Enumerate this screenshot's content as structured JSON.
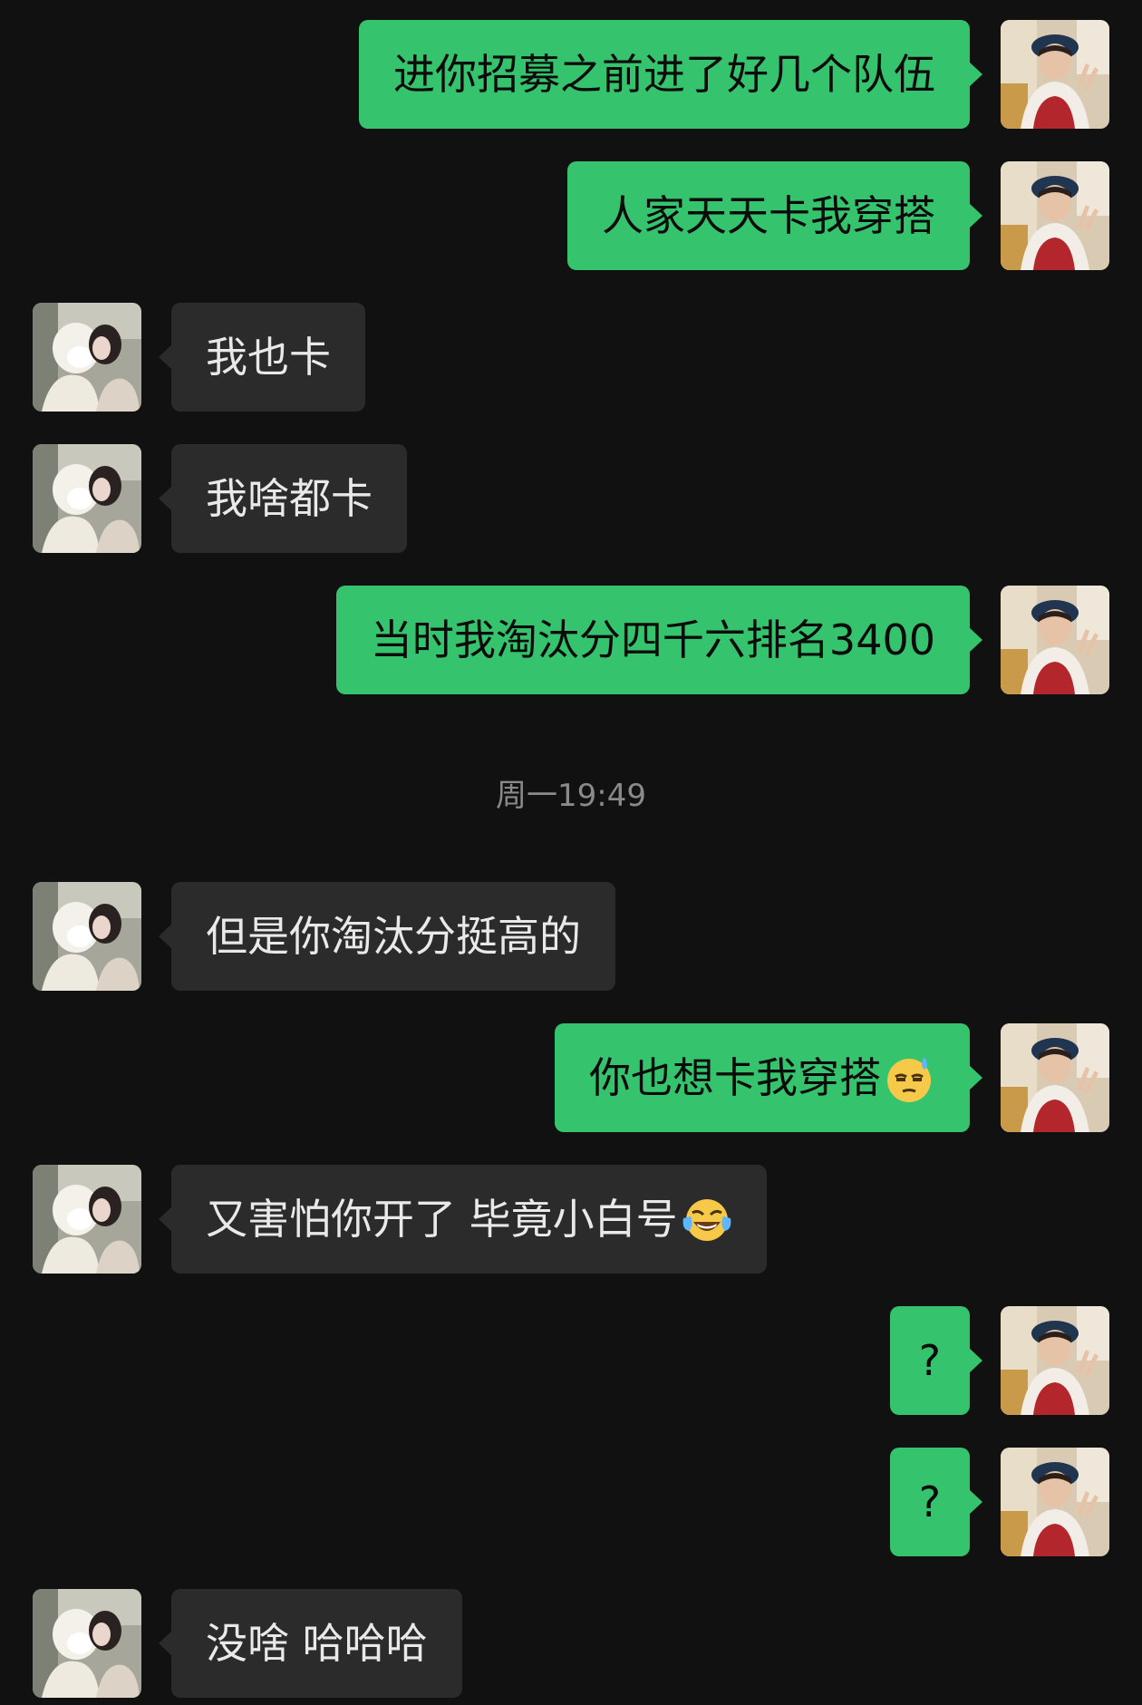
{
  "chat": {
    "timestamp": "周一19:49",
    "messages": [
      {
        "sender": "me",
        "text": "进你招募之前进了好几个队伍"
      },
      {
        "sender": "me",
        "text": "人家天天卡我穿搭"
      },
      {
        "sender": "other",
        "text": "我也卡"
      },
      {
        "sender": "other",
        "text": "我啥都卡"
      },
      {
        "sender": "me",
        "text": "当时我淘汰分四千六排名3400"
      },
      {
        "sender": "other",
        "text": "但是你淘汰分挺高的"
      },
      {
        "sender": "me",
        "text": "你也想卡我穿搭",
        "emoji": "sweat-face-emoji"
      },
      {
        "sender": "other",
        "text": "又害怕你开了 毕竟小白号",
        "emoji": "tears-of-joy-emoji"
      },
      {
        "sender": "me",
        "text": "?"
      },
      {
        "sender": "me",
        "text": "?"
      },
      {
        "sender": "other",
        "text": "没啥 哈哈哈"
      }
    ]
  },
  "colors": {
    "background": "#111111",
    "my_bubble": "#35c36d",
    "other_bubble": "#2b2b2b",
    "timestamp_text": "#8a8a8a"
  }
}
